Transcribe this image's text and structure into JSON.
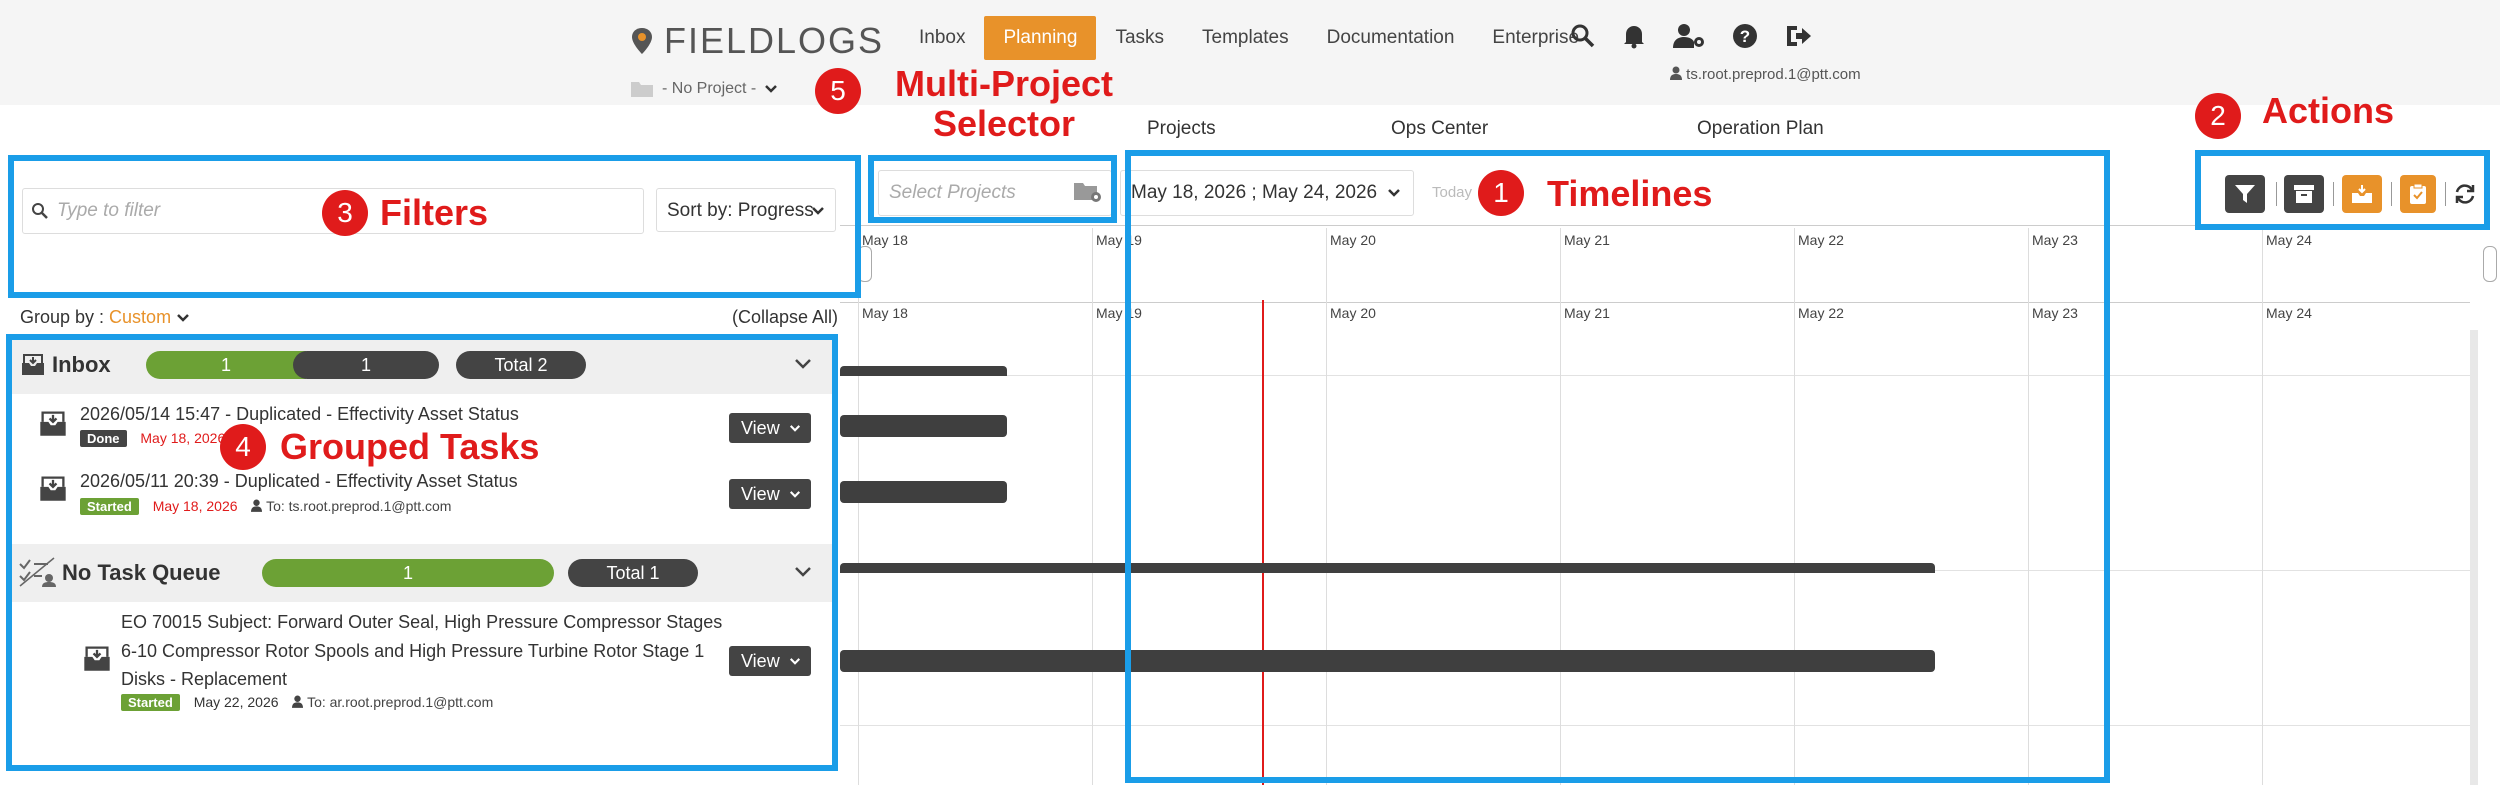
{
  "header": {
    "logo_text": "FIELDLOGS",
    "nav": [
      "Inbox",
      "Planning",
      "Tasks",
      "Templates",
      "Documentation",
      "Enterprise"
    ],
    "active_nav": "Planning",
    "user": "ts.root.preprod.1@ptt.com",
    "project_selector": "- No Project -"
  },
  "subnav": [
    "Projects",
    "Ops Center",
    "Operation Plan"
  ],
  "toolbar": {
    "filter_placeholder": "Type to filter",
    "sort_label": "Sort by: Progress",
    "projects_placeholder": "Select Projects",
    "date_range": "May 18, 2026 ; May 24, 2026",
    "today_label": "Today",
    "group_by_label": "Group by : ",
    "group_by_value": "Custom",
    "collapse_all": "(Collapse All)"
  },
  "timeline": {
    "days": [
      "May 18",
      "May 19",
      "May 20",
      "May 21",
      "May 22",
      "May 23",
      "May 24"
    ]
  },
  "groups": [
    {
      "name": "Inbox",
      "pills": [
        "1",
        "1",
        "Total 2"
      ],
      "tasks": [
        {
          "title": "2026/05/14 15:47 - Duplicated - Effectivity Asset Status",
          "status": "Done",
          "date": "May 18, 2026",
          "assignee": "",
          "view": "View"
        },
        {
          "title": "2026/05/11 20:39 - Duplicated - Effectivity Asset Status",
          "status": "Started",
          "date": "May 18, 2026",
          "assignee": "To: ts.root.preprod.1@ptt.com",
          "view": "View"
        }
      ]
    },
    {
      "name": "No Task Queue",
      "pills": [
        "1",
        "Total 1"
      ],
      "tasks": [
        {
          "title_lines": [
            "EO 70015 Subject: Forward Outer Seal, High Pressure Compressor Stages",
            "6-10 Compressor Rotor Spools and High Pressure Turbine Rotor Stage 1",
            "Disks - Replacement"
          ],
          "status": "Started",
          "date": "May 22, 2026",
          "assignee": "To: ar.root.preprod.1@ptt.com",
          "view": "View"
        }
      ]
    }
  ],
  "annotations": [
    {
      "num": "1",
      "label": "Timelines"
    },
    {
      "num": "2",
      "label": "Actions"
    },
    {
      "num": "3",
      "label": "Filters"
    },
    {
      "num": "4",
      "label": "Grouped Tasks"
    },
    {
      "num": "5",
      "label": "Multi-Project Selector"
    }
  ],
  "colors": {
    "accent": "#e8922a",
    "annotation_box": "#1a9de8",
    "annotation_red": "#e01b1b",
    "green": "#6ca135",
    "dark": "#444444"
  }
}
